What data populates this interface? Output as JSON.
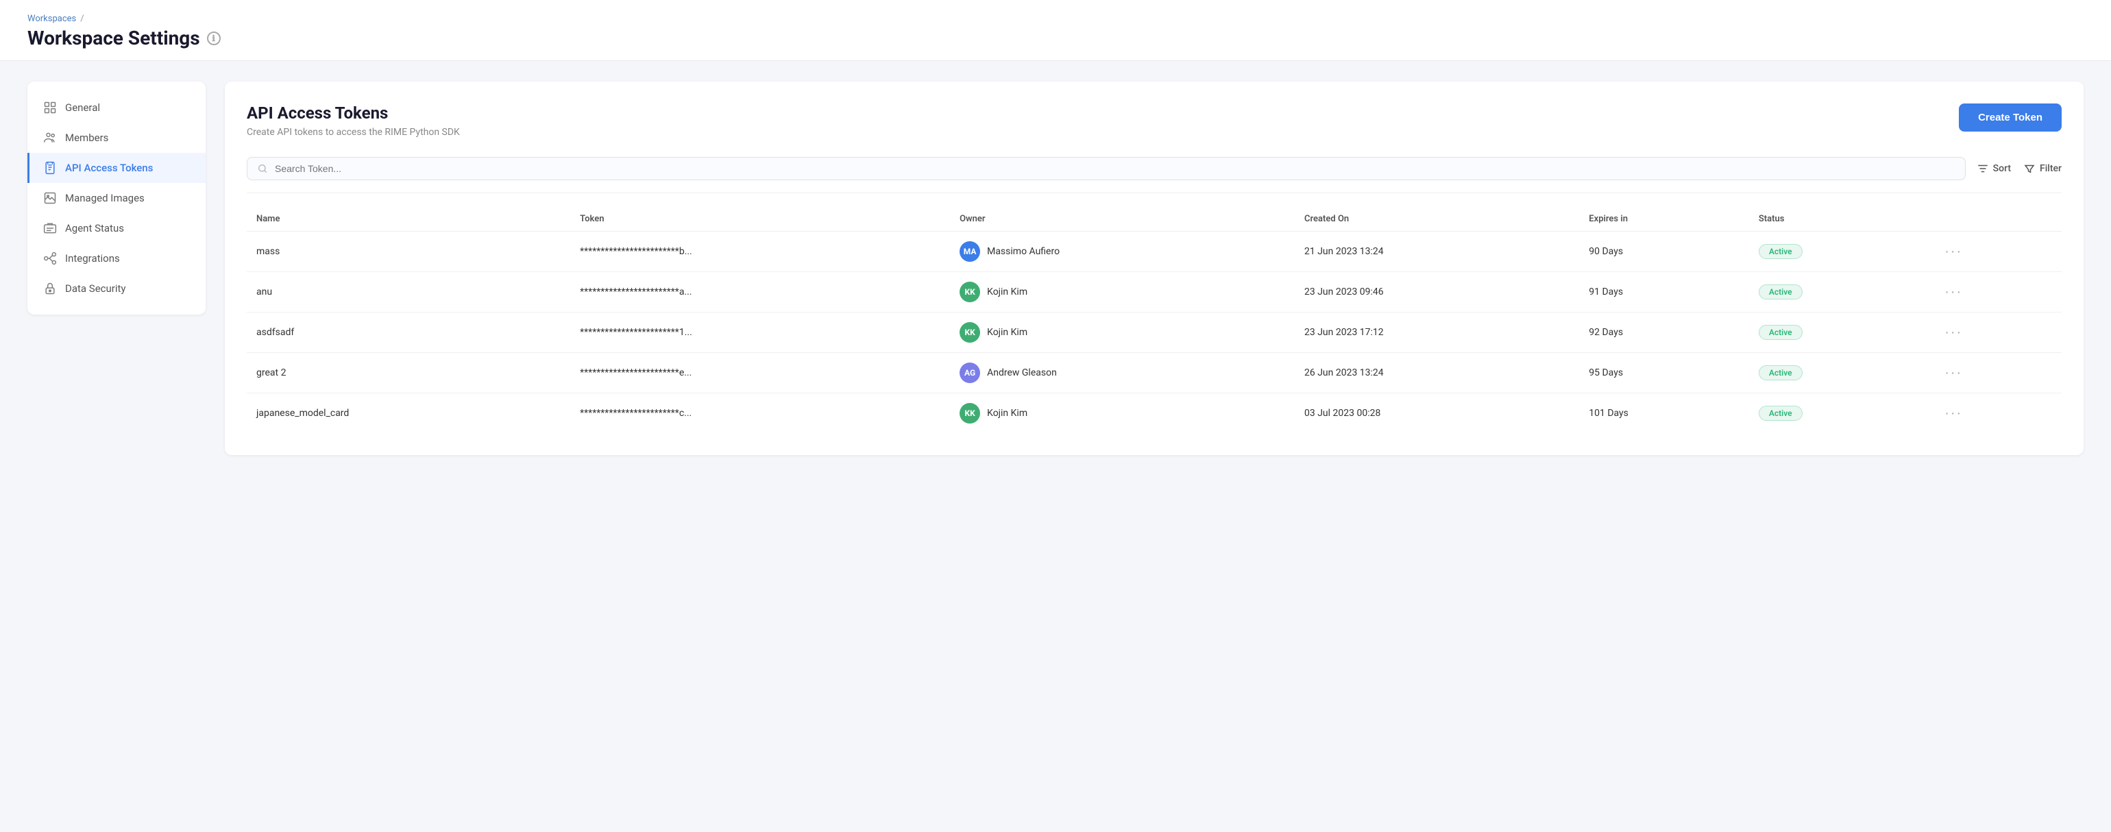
{
  "breadcrumb": {
    "parent": "Workspaces",
    "separator": "/"
  },
  "page": {
    "title": "Workspace Settings",
    "info_icon": "ℹ"
  },
  "sidebar": {
    "items": [
      {
        "id": "general",
        "label": "General",
        "icon": "general",
        "active": false
      },
      {
        "id": "members",
        "label": "Members",
        "icon": "members",
        "active": false
      },
      {
        "id": "api-access-tokens",
        "label": "API Access Tokens",
        "icon": "api",
        "active": true
      },
      {
        "id": "managed-images",
        "label": "Managed Images",
        "icon": "images",
        "active": false
      },
      {
        "id": "agent-status",
        "label": "Agent Status",
        "icon": "agent",
        "active": false
      },
      {
        "id": "integrations",
        "label": "Integrations",
        "icon": "integrations",
        "active": false
      },
      {
        "id": "data-security",
        "label": "Data Security",
        "icon": "security",
        "active": false
      }
    ]
  },
  "content": {
    "title": "API Access Tokens",
    "subtitle": "Create API tokens to access the RIME Python SDK",
    "create_button": "Create Token",
    "search_placeholder": "Search Token...",
    "sort_label": "Sort",
    "filter_label": "Filter",
    "table": {
      "columns": [
        "Name",
        "Token",
        "Owner",
        "Created On",
        "Expires in",
        "Status"
      ],
      "rows": [
        {
          "name": "mass",
          "token": "************************b...",
          "owner_initials": "MA",
          "owner_name": "Massimo Aufiero",
          "owner_avatar_class": "avatar-ma",
          "created_on": "21 Jun 2023 13:24",
          "expires_in": "90 Days",
          "status": "Active"
        },
        {
          "name": "anu",
          "token": "************************a...",
          "owner_initials": "KK",
          "owner_name": "Kojin Kim",
          "owner_avatar_class": "avatar-kk",
          "created_on": "23 Jun 2023 09:46",
          "expires_in": "91 Days",
          "status": "Active"
        },
        {
          "name": "asdfsadf",
          "token": "************************1...",
          "owner_initials": "KK",
          "owner_name": "Kojin Kim",
          "owner_avatar_class": "avatar-kk",
          "created_on": "23 Jun 2023 17:12",
          "expires_in": "92 Days",
          "status": "Active"
        },
        {
          "name": "great 2",
          "token": "************************e...",
          "owner_initials": "AG",
          "owner_name": "Andrew Gleason",
          "owner_avatar_class": "avatar-ag",
          "created_on": "26 Jun 2023 13:24",
          "expires_in": "95 Days",
          "status": "Active"
        },
        {
          "name": "japanese_model_card",
          "token": "************************c...",
          "owner_initials": "KK",
          "owner_name": "Kojin Kim",
          "owner_avatar_class": "avatar-kk",
          "created_on": "03 Jul 2023 00:28",
          "expires_in": "101 Days",
          "status": "Active"
        }
      ]
    }
  }
}
